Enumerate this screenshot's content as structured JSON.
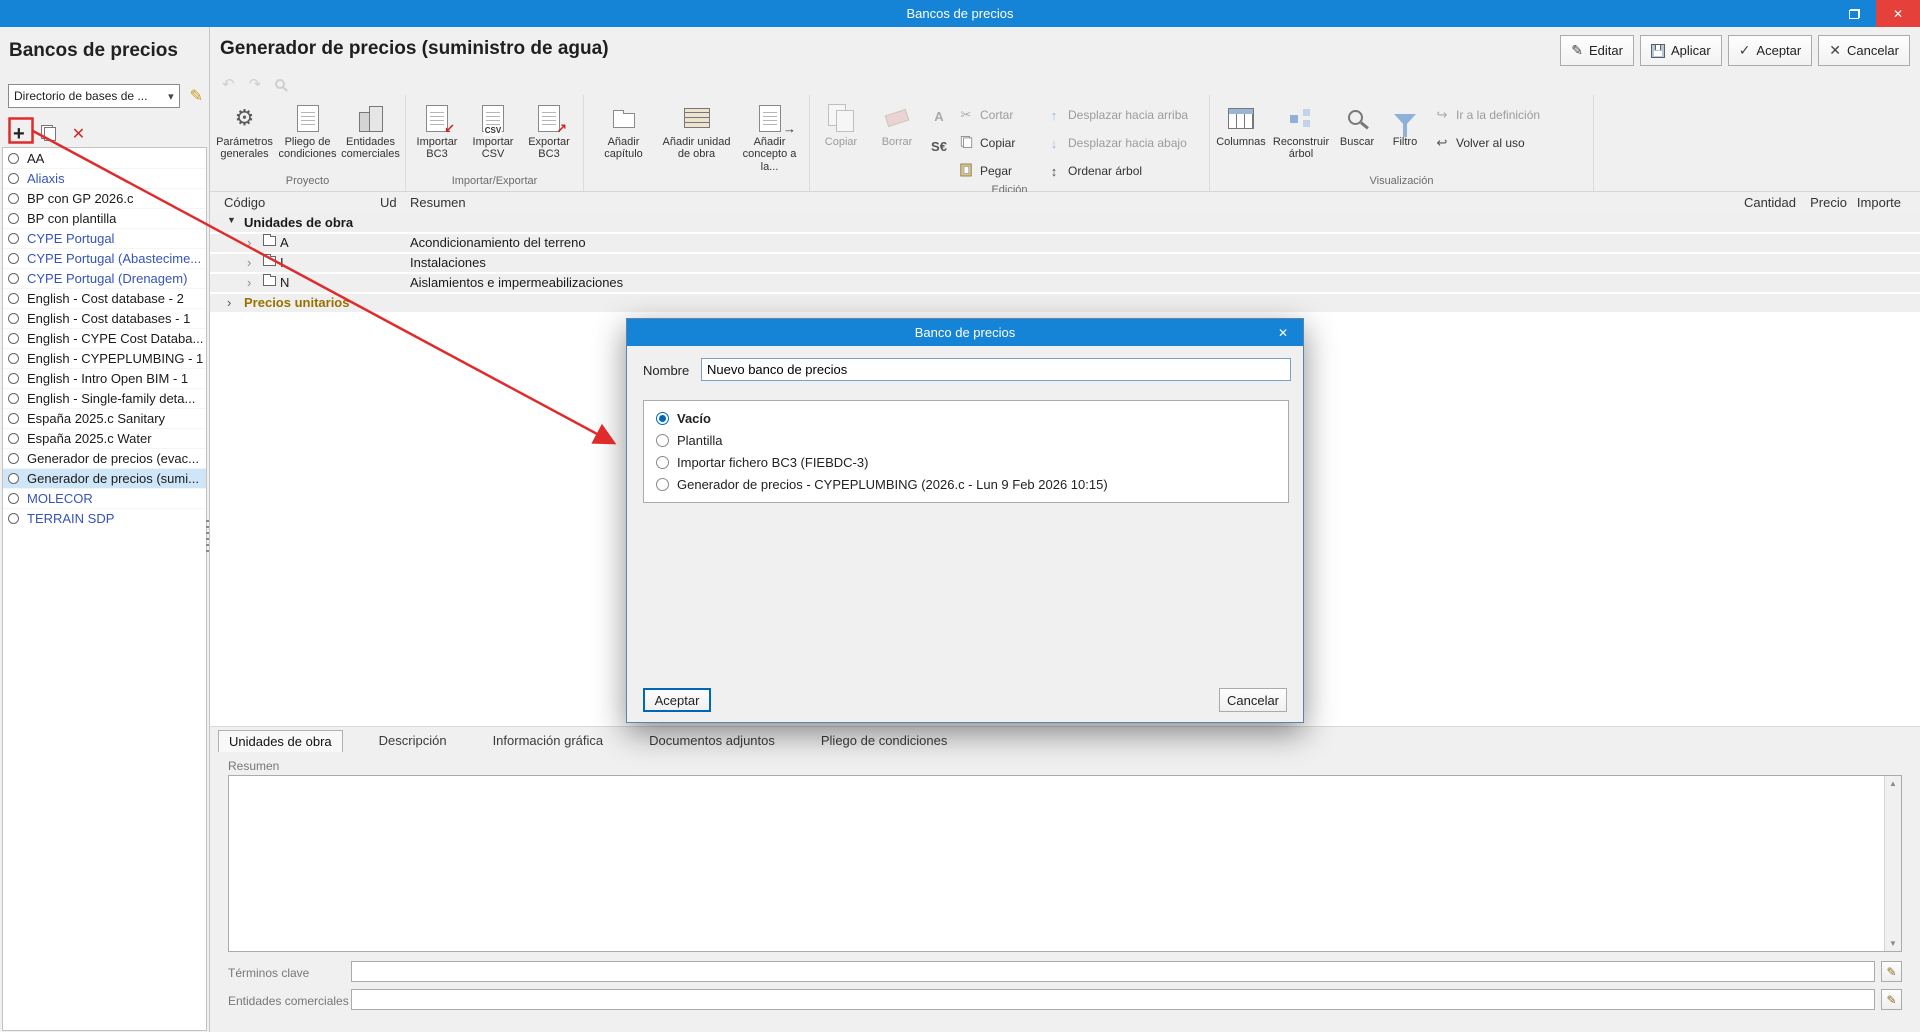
{
  "icons": {
    "gear": "⚙",
    "pencil": "✎",
    "plus": "+",
    "delete_cross": "✕",
    "close": "✕",
    "check": "✓",
    "cancel_cross": "✕",
    "undo": "↶",
    "redo": "↷",
    "dropdown_arrow": "▾",
    "chevron_expanded": "▼",
    "chevron_collapsed": "›",
    "scissors": "✂",
    "arrow_up": "↑",
    "arrow_down": "↓",
    "sort": "↕",
    "import_arrow": "↙",
    "export_arrow": "↗",
    "concept_arrow": "→",
    "csv_label": "CSV",
    "letter_a": "A",
    "currency": "S€",
    "goto_definition": "↪",
    "back_to_use": "↩",
    "scroll_up": "▲",
    "scroll_down": "▼"
  },
  "titlebar": {
    "title": "Bancos de precios"
  },
  "sidebar": {
    "title": "Bancos de precios",
    "directory_dropdown": "Directorio de bases de ...",
    "items": [
      {
        "label": "AA"
      },
      {
        "label": "Aliaxis"
      },
      {
        "label": "BP con GP 2026.c"
      },
      {
        "label": "BP con plantilla"
      },
      {
        "label": "CYPE Portugal"
      },
      {
        "label": "CYPE Portugal (Abastecime..."
      },
      {
        "label": "CYPE Portugal (Drenagem)"
      },
      {
        "label": "English - Cost database - 2"
      },
      {
        "label": "English - Cost databases - 1"
      },
      {
        "label": "English - CYPE Cost Databa..."
      },
      {
        "label": "English - CYPEPLUMBING - 1"
      },
      {
        "label": "English - Intro Open BIM - 1"
      },
      {
        "label": "English - Single-family deta..."
      },
      {
        "label": "España 2025.c Sanitary"
      },
      {
        "label": "España 2025.c Water"
      },
      {
        "label": "Generador de precios (evac..."
      },
      {
        "label": "Generador de precios (sumi..."
      },
      {
        "label": "MOLECOR"
      },
      {
        "label": "TERRAIN SDP"
      }
    ]
  },
  "header": {
    "title": "Generador de precios (suministro de agua)",
    "editar": "Editar",
    "aplicar": "Aplicar",
    "aceptar": "Aceptar",
    "cancelar": "Cancelar"
  },
  "ribbon": {
    "proyecto": {
      "label": "Proyecto",
      "items": [
        "Parámetros generales",
        "Pliego de condiciones",
        "Entidades comerciales"
      ]
    },
    "importar": {
      "label": "Importar/Exportar",
      "items": [
        "Importar BC3",
        "Importar CSV",
        "Exportar BC3"
      ]
    },
    "anadir": {
      "label": "",
      "items": [
        "Añadir capítulo",
        "Añadir unidad de obra",
        "Añadir concepto a la..."
      ]
    },
    "edicion": {
      "label": "Edición",
      "big": [
        "Copiar",
        "Borrar"
      ],
      "small": [
        "Cortar",
        "Copiar",
        "Pegar",
        "Desplazar hacia arriba",
        "Desplazar hacia abajo",
        "Ordenar árbol"
      ]
    },
    "visualizacion": {
      "label": "Visualización",
      "big": [
        "Columnas",
        "Reconstruir árbol",
        "Buscar",
        "Filtro"
      ],
      "small": [
        "Ir a la definición",
        "Volver al uso"
      ]
    }
  },
  "grid": {
    "columns": {
      "codigo": "Código",
      "ud": "Ud",
      "resumen": "Resumen",
      "cantidad": "Cantidad",
      "precio": "Precio",
      "importe": "Importe"
    },
    "rows": [
      {
        "code": "Unidades de obra",
        "resumen": ""
      },
      {
        "code": "A",
        "resumen": "Acondicionamiento del terreno"
      },
      {
        "code": "I",
        "resumen": "Instalaciones"
      },
      {
        "code": "N",
        "resumen": "Aislamientos e impermeabilizaciones"
      },
      {
        "code": "Precios unitarios",
        "resumen": ""
      }
    ]
  },
  "dialog": {
    "title": "Banco de precios",
    "name_label": "Nombre",
    "name_value": "Nuevo banco de precios",
    "options": [
      {
        "label": "Vacío"
      },
      {
        "label": "Plantilla"
      },
      {
        "label": "Importar fichero BC3 (FIEBDC-3)"
      },
      {
        "label": "Generador de precios - CYPEPLUMBING (2026.c - Lun  9 Feb 2026  10:15)"
      }
    ],
    "accept_label": "Aceptar",
    "cancel_label": "Cancelar"
  },
  "bottom": {
    "tabs": [
      "Unidades de obra",
      "Descripción",
      "Información gráfica",
      "Documentos adjuntos",
      "Pliego de condiciones"
    ],
    "resumen_label": "Resumen",
    "terminos_label": "Términos clave",
    "entidades_label": "Entidades comerciales"
  }
}
